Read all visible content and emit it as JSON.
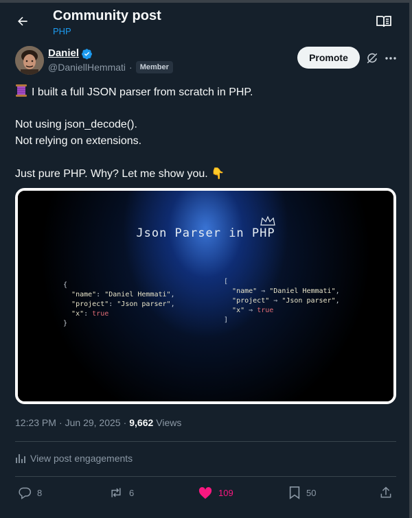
{
  "header": {
    "title": "Community post",
    "subtitle": "PHP"
  },
  "author": {
    "name": "Daniel",
    "handle": "@DaniellHemmati",
    "separator": "·",
    "badge": "Member"
  },
  "buttons": {
    "promote": "Promote"
  },
  "post": {
    "line1": "I built a full JSON parser from scratch in PHP.",
    "line2": "Not using json_decode().",
    "line3": "Not relying on extensions.",
    "line4": "Just pure PHP. Why? Let me show you. 👇"
  },
  "media": {
    "title": "Json Parser in PHP",
    "left_code": {
      "open": "{",
      "k1": "\"name\"",
      "v1": "\"Daniel Hemmati\"",
      "k2": "\"project\"",
      "v2": "\"Json parser\"",
      "k3": "\"x\"",
      "v3": "true",
      "close": "}"
    },
    "right_code": {
      "open": "[",
      "k1": "\"name\"",
      "v1": "\"Daniel Hemmati\"",
      "k2": "\"project\"",
      "v2": "\"Json parser\"",
      "k3": "\"x\"",
      "v3": "true",
      "arrow": "⇒",
      "close": "]"
    }
  },
  "meta": {
    "time": "12:23 PM",
    "dot1": "·",
    "date": "Jun 29, 2025",
    "dot2": "·",
    "views_count": "9,662",
    "views_label": "Views"
  },
  "engagements": {
    "label": "View post engagements"
  },
  "actions": {
    "replies": "8",
    "reposts": "6",
    "likes": "109",
    "bookmarks": "50"
  },
  "colors": {
    "background": "#15202b",
    "accent": "#1d9bf0",
    "like": "#f91880"
  },
  "icons": [
    "back-arrow-icon",
    "reader-icon",
    "verified-icon",
    "grok-icon",
    "more-icon",
    "spool-icon",
    "analytics-icon",
    "reply-icon",
    "repost-icon",
    "like-icon",
    "bookmark-icon",
    "share-icon"
  ]
}
